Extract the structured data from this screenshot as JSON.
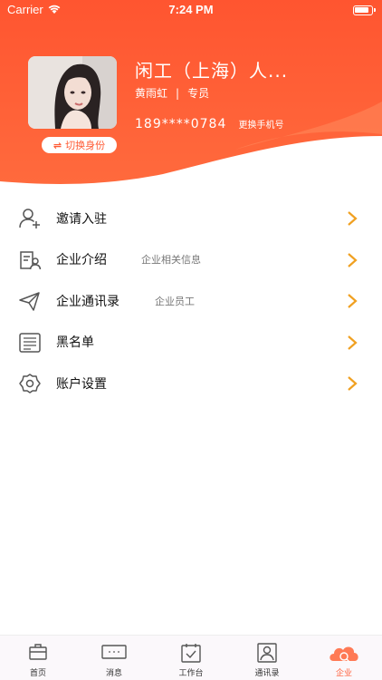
{
  "status_bar": {
    "carrier": "Carrier",
    "time": "7:24 PM"
  },
  "profile": {
    "company_name": "闲工（上海）人...",
    "user_name": "黄雨虹",
    "separator": "|",
    "role": "专员",
    "phone": "189****0784",
    "change_phone_label": "更换手机号",
    "switch_role_label": "切换身份",
    "avatar_icon": "avatar-photo"
  },
  "menu": {
    "items": [
      {
        "label": "邀请入驻",
        "sub": "",
        "icon": "user-add-icon"
      },
      {
        "label": "企业介绍",
        "sub": "企业相关信息",
        "icon": "company-doc-icon"
      },
      {
        "label": "企业通讯录",
        "sub": "企业员工",
        "icon": "send-icon"
      },
      {
        "label": "黑名单",
        "sub": "",
        "icon": "list-icon"
      },
      {
        "label": "账户设置",
        "sub": "",
        "icon": "gear-icon"
      }
    ]
  },
  "tabbar": {
    "tabs": [
      {
        "label": "首页",
        "icon": "briefcase-icon"
      },
      {
        "label": "消息",
        "icon": "message-icon"
      },
      {
        "label": "工作台",
        "icon": "calendar-check-icon"
      },
      {
        "label": "通讯录",
        "icon": "contacts-icon"
      },
      {
        "label": "企业",
        "icon": "company-icon",
        "active": true
      }
    ]
  },
  "colors": {
    "brand": "#ff5b35",
    "arrow": "#f0a020",
    "header_gradient_end": "#ff7a45"
  }
}
